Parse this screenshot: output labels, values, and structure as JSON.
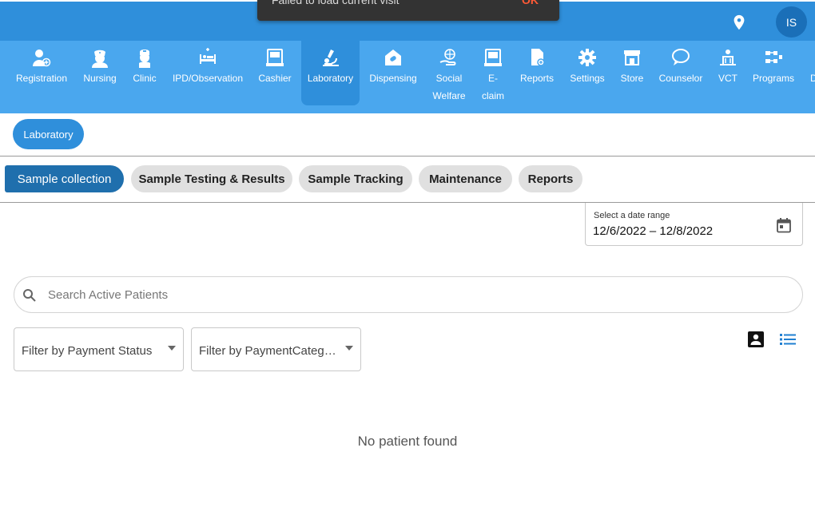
{
  "snackbar": {
    "message": "Failed to load current visit",
    "action": "OK"
  },
  "header": {
    "avatar_initials": "IS",
    "location_icon": "location-pin-icon"
  },
  "modules": [
    {
      "label": "Registration",
      "icon": "add-person-icon"
    },
    {
      "label": "Nursing",
      "icon": "nurse-icon"
    },
    {
      "label": "Clinic",
      "icon": "doctor-icon"
    },
    {
      "label": "IPD/Observation",
      "icon": "bed-icon"
    },
    {
      "label": "Cashier",
      "icon": "cash-register-icon"
    },
    {
      "label": "Laboratory",
      "icon": "microscope-icon",
      "active": true
    },
    {
      "label": "Dispensing",
      "icon": "pill-house-icon"
    },
    {
      "label": "Social",
      "label2": "Welfare",
      "icon": "hand-globe-icon"
    },
    {
      "label": "E-",
      "label2": "claim",
      "icon": "e-claim-icon"
    },
    {
      "label": "Reports",
      "icon": "report-icon"
    },
    {
      "label": "Settings",
      "icon": "gear-icon"
    },
    {
      "label": "Store",
      "icon": "store-icon"
    },
    {
      "label": "Counselor",
      "icon": "chat-icon"
    },
    {
      "label": "VCT",
      "icon": "vct-icon"
    },
    {
      "label": "Programs",
      "icon": "programs-icon"
    },
    {
      "label": "D",
      "icon": "more-icon"
    }
  ],
  "breadcrumb": {
    "label": "Laboratory"
  },
  "subtabs": [
    {
      "label": "Sample collection",
      "active": true
    },
    {
      "label": "Sample Testing & Results"
    },
    {
      "label": "Sample Tracking"
    },
    {
      "label": "Maintenance"
    },
    {
      "label": "Reports"
    }
  ],
  "date_range": {
    "label": "Select a date range",
    "value": "12/6/2022 – 12/8/2022"
  },
  "search": {
    "placeholder": "Search Active Patients",
    "value": ""
  },
  "filters": {
    "payment_status": "Filter by Payment Status",
    "payment_category": "Filter by PaymentCatego…"
  },
  "empty_message": "No patient found",
  "colors": {
    "header": "#2f8fdb",
    "nav": "#4aa7ee",
    "active_tab": "#1f6fad",
    "snackbar_action": "#ff5a36"
  }
}
